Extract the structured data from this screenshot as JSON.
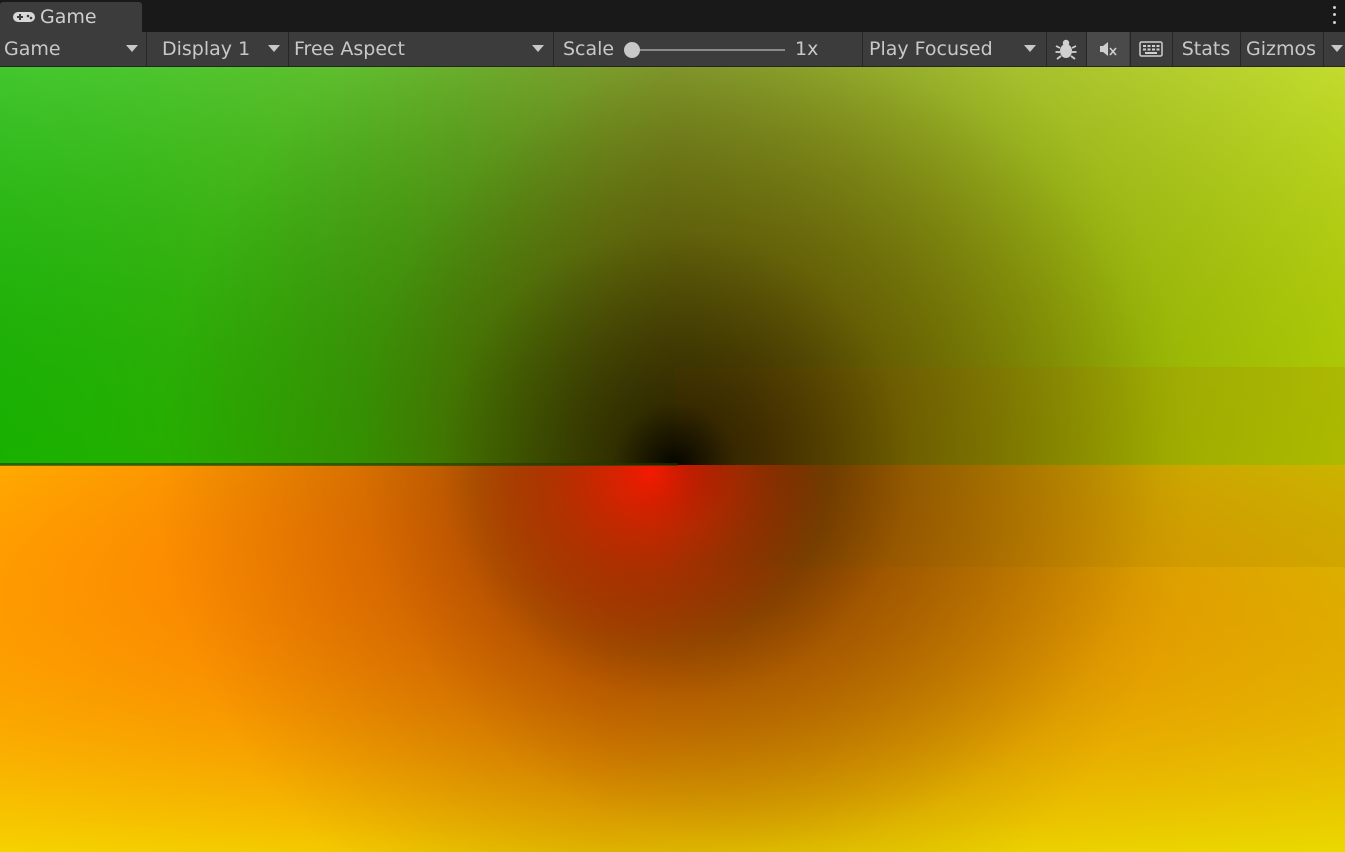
{
  "tab": {
    "title": "Game",
    "icon": "gamepad-icon",
    "menu_icon": "kebab-menu-icon"
  },
  "toolbar": {
    "view_dropdown": "Game",
    "display_dropdown": "Display 1",
    "aspect_dropdown": "Free Aspect",
    "scale_label": "Scale",
    "scale_value": "1x",
    "scale_level": 0,
    "play_mode_dropdown": "Play Focused",
    "debug_icon": "bug-icon",
    "mute_icon": "mute-audio-icon",
    "keyboard_icon": "keyboard-icon",
    "stats_label": "Stats",
    "gizmos_label": "Gizmos"
  },
  "colors": {
    "panel_bg": "#3c3c3c",
    "window_bg": "#191919",
    "text": "#c8c8c8",
    "gradient_green": "#22cc00",
    "gradient_yellow": "#ddee00",
    "gradient_orange": "#ff9900",
    "gradient_red": "#ff2200"
  }
}
